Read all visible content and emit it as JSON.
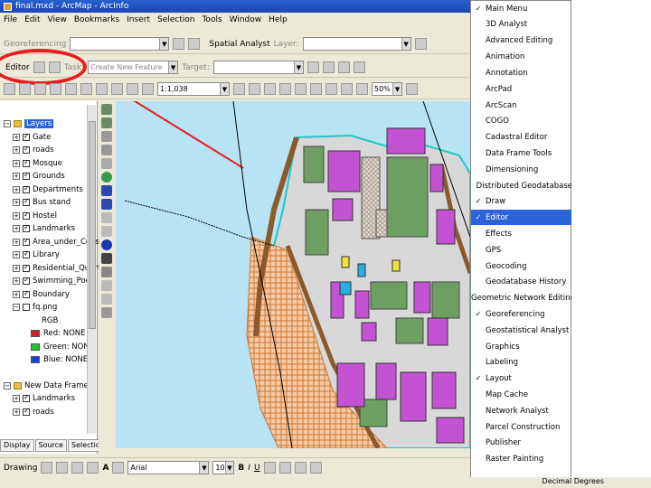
{
  "window": {
    "title": "final.mxd - ArcMap - ArcInfo",
    "buttons": {
      "minimize": "–",
      "maximize": "□",
      "close": "✕"
    }
  },
  "menubar": {
    "items": [
      "File",
      "Edit",
      "View",
      "Bookmarks",
      "Insert",
      "Selection",
      "Tools",
      "Window",
      "Help"
    ]
  },
  "toolbars": {
    "georeferencing_label": "Georeferencing",
    "spatial_analyst_label": "Spatial Analyst",
    "layer_label": "Layer:",
    "editor_label": "Editor",
    "task_label": "Task:",
    "task_value": "Create New Feature",
    "target_label": "Target:",
    "scale_value": "1:1,038",
    "percent_value": "50%"
  },
  "toc": {
    "root": "Layers",
    "layers": [
      "Gate",
      "roads",
      "Mosque",
      "Grounds",
      "Departments",
      "Bus stand",
      "Hostel",
      "Landmarks",
      "Area_under_Constr",
      "Library",
      "Residential_Quarter",
      "Swimming_Pool",
      "Boundary",
      "fq.png"
    ],
    "rgb": {
      "title": "RGB",
      "bands": [
        {
          "label": "Red:  NONE",
          "color": "#d42020"
        },
        {
          "label": "Green: NONE",
          "color": "#22c22a"
        },
        {
          "label": "Blue:  NONE",
          "color": "#1f3fd8"
        }
      ]
    },
    "frame2": {
      "title": "New Data Frame",
      "layers": [
        "Landmarks",
        "roads"
      ]
    },
    "tabs": [
      "Display",
      "Source",
      "Selection"
    ]
  },
  "drawing": {
    "label": "Drawing",
    "font_value": "Arial",
    "size_value": "10",
    "bold": "B",
    "italic": "I",
    "underline": "U",
    "text_tool": "A"
  },
  "toolbar_menu": {
    "items": [
      {
        "label": "Main Menu",
        "checked": true
      },
      {
        "label": "3D Analyst",
        "checked": false
      },
      {
        "label": "Advanced Editing",
        "checked": false
      },
      {
        "label": "Animation",
        "checked": false
      },
      {
        "label": "Annotation",
        "checked": false
      },
      {
        "label": "ArcPad",
        "checked": false
      },
      {
        "label": "ArcScan",
        "checked": false
      },
      {
        "label": "COGO",
        "checked": false
      },
      {
        "label": "Cadastral Editor",
        "checked": false
      },
      {
        "label": "Data Frame Tools",
        "checked": false
      },
      {
        "label": "Dimensioning",
        "checked": false
      },
      {
        "label": "Distributed Geodatabase",
        "checked": false
      },
      {
        "label": "Draw",
        "checked": true
      },
      {
        "label": "Editor",
        "checked": true,
        "selected": true
      },
      {
        "label": "Effects",
        "checked": false
      },
      {
        "label": "GPS",
        "checked": false
      },
      {
        "label": "Geocoding",
        "checked": false
      },
      {
        "label": "Geodatabase History",
        "checked": false
      },
      {
        "label": "Geometric Network Editing",
        "checked": false
      },
      {
        "label": "Georeferencing",
        "checked": true
      },
      {
        "label": "Geostatistical Analyst",
        "checked": false
      },
      {
        "label": "Graphics",
        "checked": false
      },
      {
        "label": "Labeling",
        "checked": false
      },
      {
        "label": "Layout",
        "checked": true
      },
      {
        "label": "Map Cache",
        "checked": false
      },
      {
        "label": "Network Analyst",
        "checked": false
      },
      {
        "label": "Parcel Construction",
        "checked": false
      },
      {
        "label": "Publisher",
        "checked": false
      },
      {
        "label": "Raster Painting",
        "checked": false
      }
    ],
    "more_arrow": "▼"
  },
  "status": {
    "units": "Decimal Degrees"
  },
  "colors": {
    "water": "#b8e3f4",
    "building": "#c453d4",
    "green": "#6e9f62",
    "road": "#d8d8d8",
    "highlight": "#e81d1d",
    "menu_selected": "#2a64d8"
  }
}
